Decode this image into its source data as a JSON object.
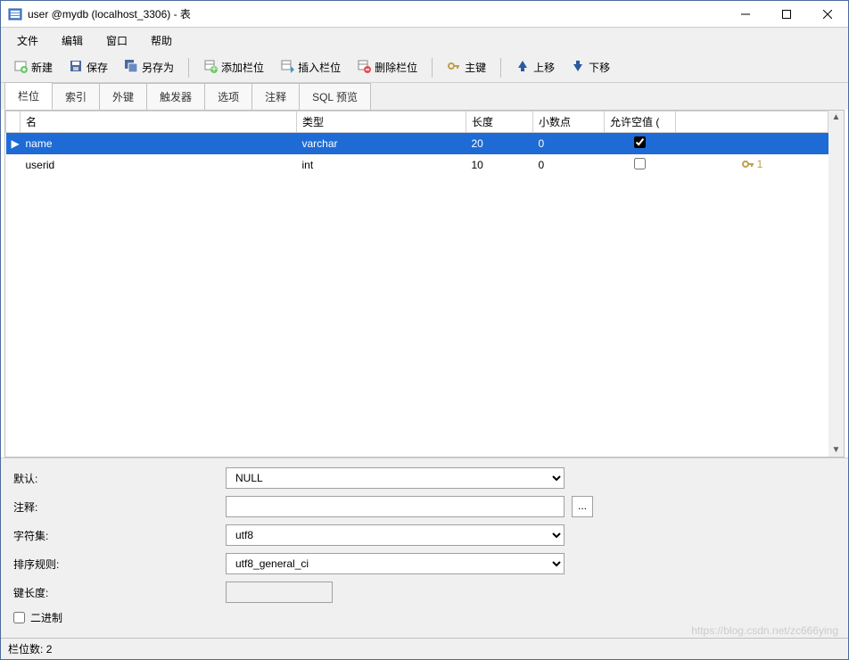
{
  "window": {
    "title": "user @mydb (localhost_3306) - 表"
  },
  "menu": {
    "file": "文件",
    "edit": "编辑",
    "window": "窗口",
    "help": "帮助"
  },
  "toolbar": {
    "new": "新建",
    "save": "保存",
    "saveas": "另存为",
    "addcol": "添加栏位",
    "inscol": "插入栏位",
    "delcol": "删除栏位",
    "pk": "主键",
    "moveup": "上移",
    "movedown": "下移"
  },
  "tabs": {
    "fields": "栏位",
    "indexes": "索引",
    "fks": "外键",
    "triggers": "触发器",
    "options": "选项",
    "comment": "注释",
    "sql": "SQL 预览",
    "active": "fields"
  },
  "grid": {
    "headers": {
      "name": "名",
      "type": "类型",
      "length": "长度",
      "decimals": "小数点",
      "nullable": "允许空值 ("
    },
    "rows": [
      {
        "name": "name",
        "type": "varchar",
        "length": "20",
        "decimals": "0",
        "nullable": true,
        "pk": false,
        "selected": true
      },
      {
        "name": "userid",
        "type": "int",
        "length": "10",
        "decimals": "0",
        "nullable": false,
        "pk": true,
        "pkindex": "1",
        "selected": false
      }
    ]
  },
  "props": {
    "labels": {
      "default": "默认:",
      "comment": "注释:",
      "charset": "字符集:",
      "collation": "排序规则:",
      "keylen": "键长度:",
      "binary": "二进制"
    },
    "values": {
      "default": "NULL",
      "comment": "",
      "charset": "utf8",
      "collation": "utf8_general_ci",
      "keylen": "",
      "binary": false
    }
  },
  "status": {
    "count_label": "栏位数:",
    "count": "2"
  },
  "watermark": "https://blog.csdn.net/zc666ying"
}
